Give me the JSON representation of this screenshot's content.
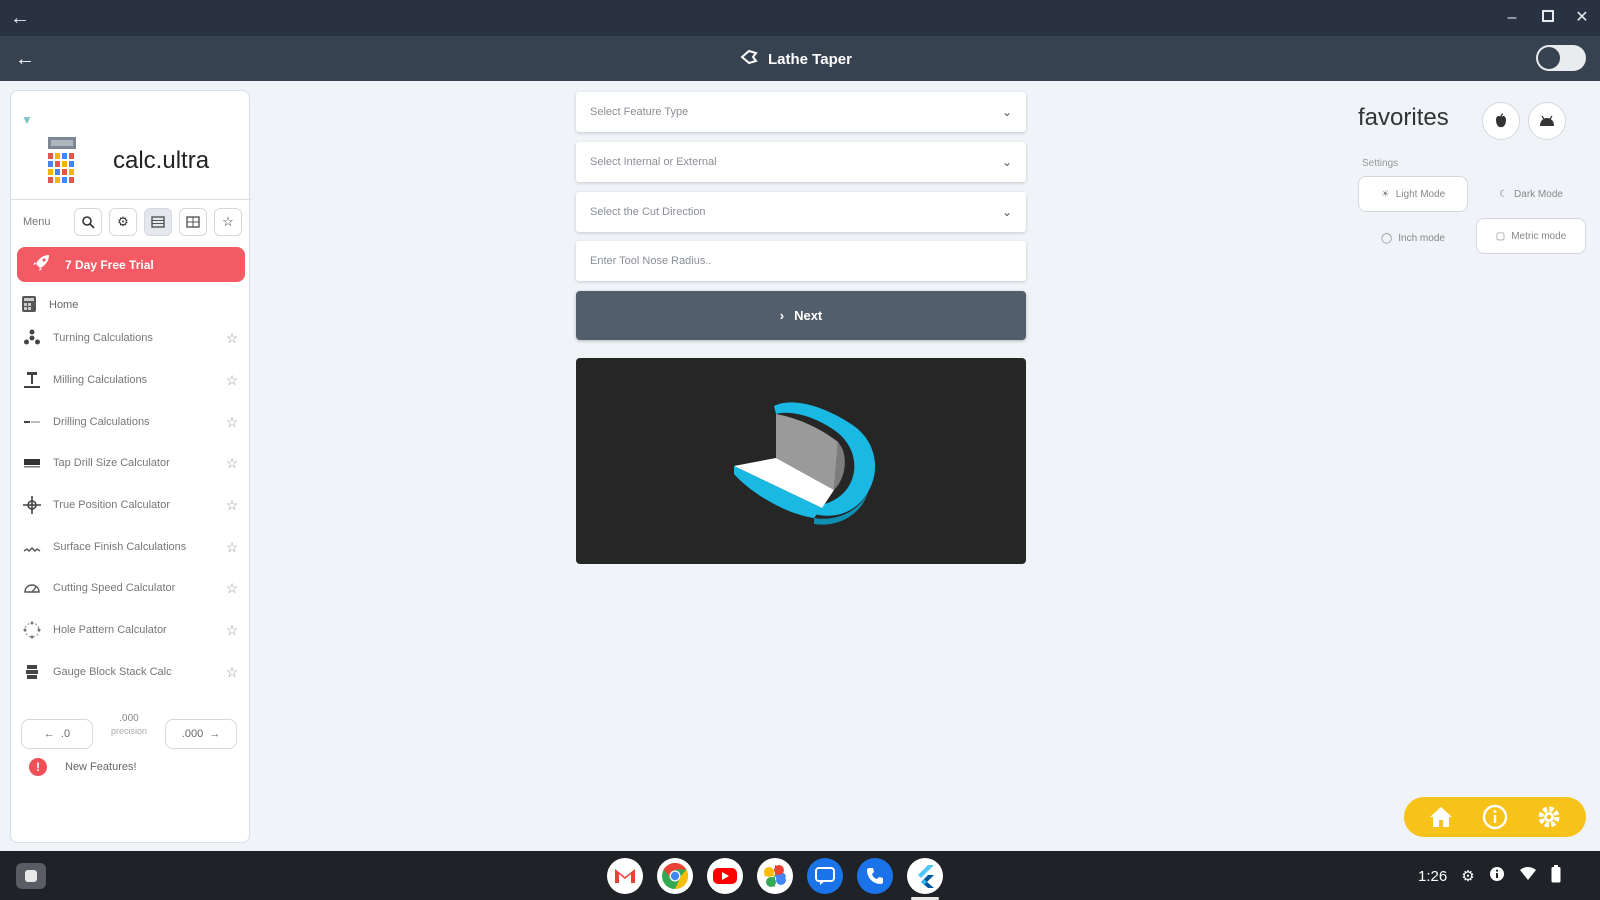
{
  "window": {
    "title": "Lathe Taper"
  },
  "sidebar": {
    "brand": "calc.ultra",
    "menu_label": "Menu",
    "trial_label": "7 Day Free Trial",
    "home_label": "Home",
    "items": [
      {
        "label": "Turning Calculations",
        "icon": "turning-icon"
      },
      {
        "label": "Milling Calculations",
        "icon": "milling-icon"
      },
      {
        "label": "Drilling Calculations",
        "icon": "drilling-icon"
      },
      {
        "label": "Tap Drill Size Calculator",
        "icon": "tap-drill-icon"
      },
      {
        "label": "True Position Calculator",
        "icon": "true-position-icon"
      },
      {
        "label": "Surface Finish Calculations",
        "icon": "surface-finish-icon"
      },
      {
        "label": "Cutting Speed Calculator",
        "icon": "cutting-speed-icon"
      },
      {
        "label": "Hole Pattern Calculator",
        "icon": "hole-pattern-icon"
      },
      {
        "label": "Gauge Block Stack Calc",
        "icon": "gauge-block-icon"
      }
    ],
    "precision": {
      "minus_label": ".0",
      "value": ".000",
      "unit": "precision",
      "plus_label": ".000"
    },
    "new_features_label": "New Features!"
  },
  "form": {
    "feature_type_placeholder": "Select Feature Type",
    "internal_external_placeholder": "Select Internal or External",
    "cut_direction_placeholder": "Select the Cut Direction",
    "nose_radius_placeholder": "Enter Tool Nose Radius..",
    "next_label": "Next"
  },
  "favorites": {
    "title": "favorites",
    "settings_label": "Settings",
    "light_mode_label": "Light Mode",
    "dark_mode_label": "Dark Mode",
    "inch_mode_label": "Inch mode",
    "metric_mode_label": "Metric mode"
  },
  "system": {
    "time": "1:26"
  },
  "colors": {
    "accent": "#f45a63",
    "fab": "#f7c21a",
    "titlebar": "#283241",
    "appbar": "#364250",
    "next_button": "#525e6c",
    "preview_bg": "#262626",
    "part_cyan": "#19b9e3"
  }
}
